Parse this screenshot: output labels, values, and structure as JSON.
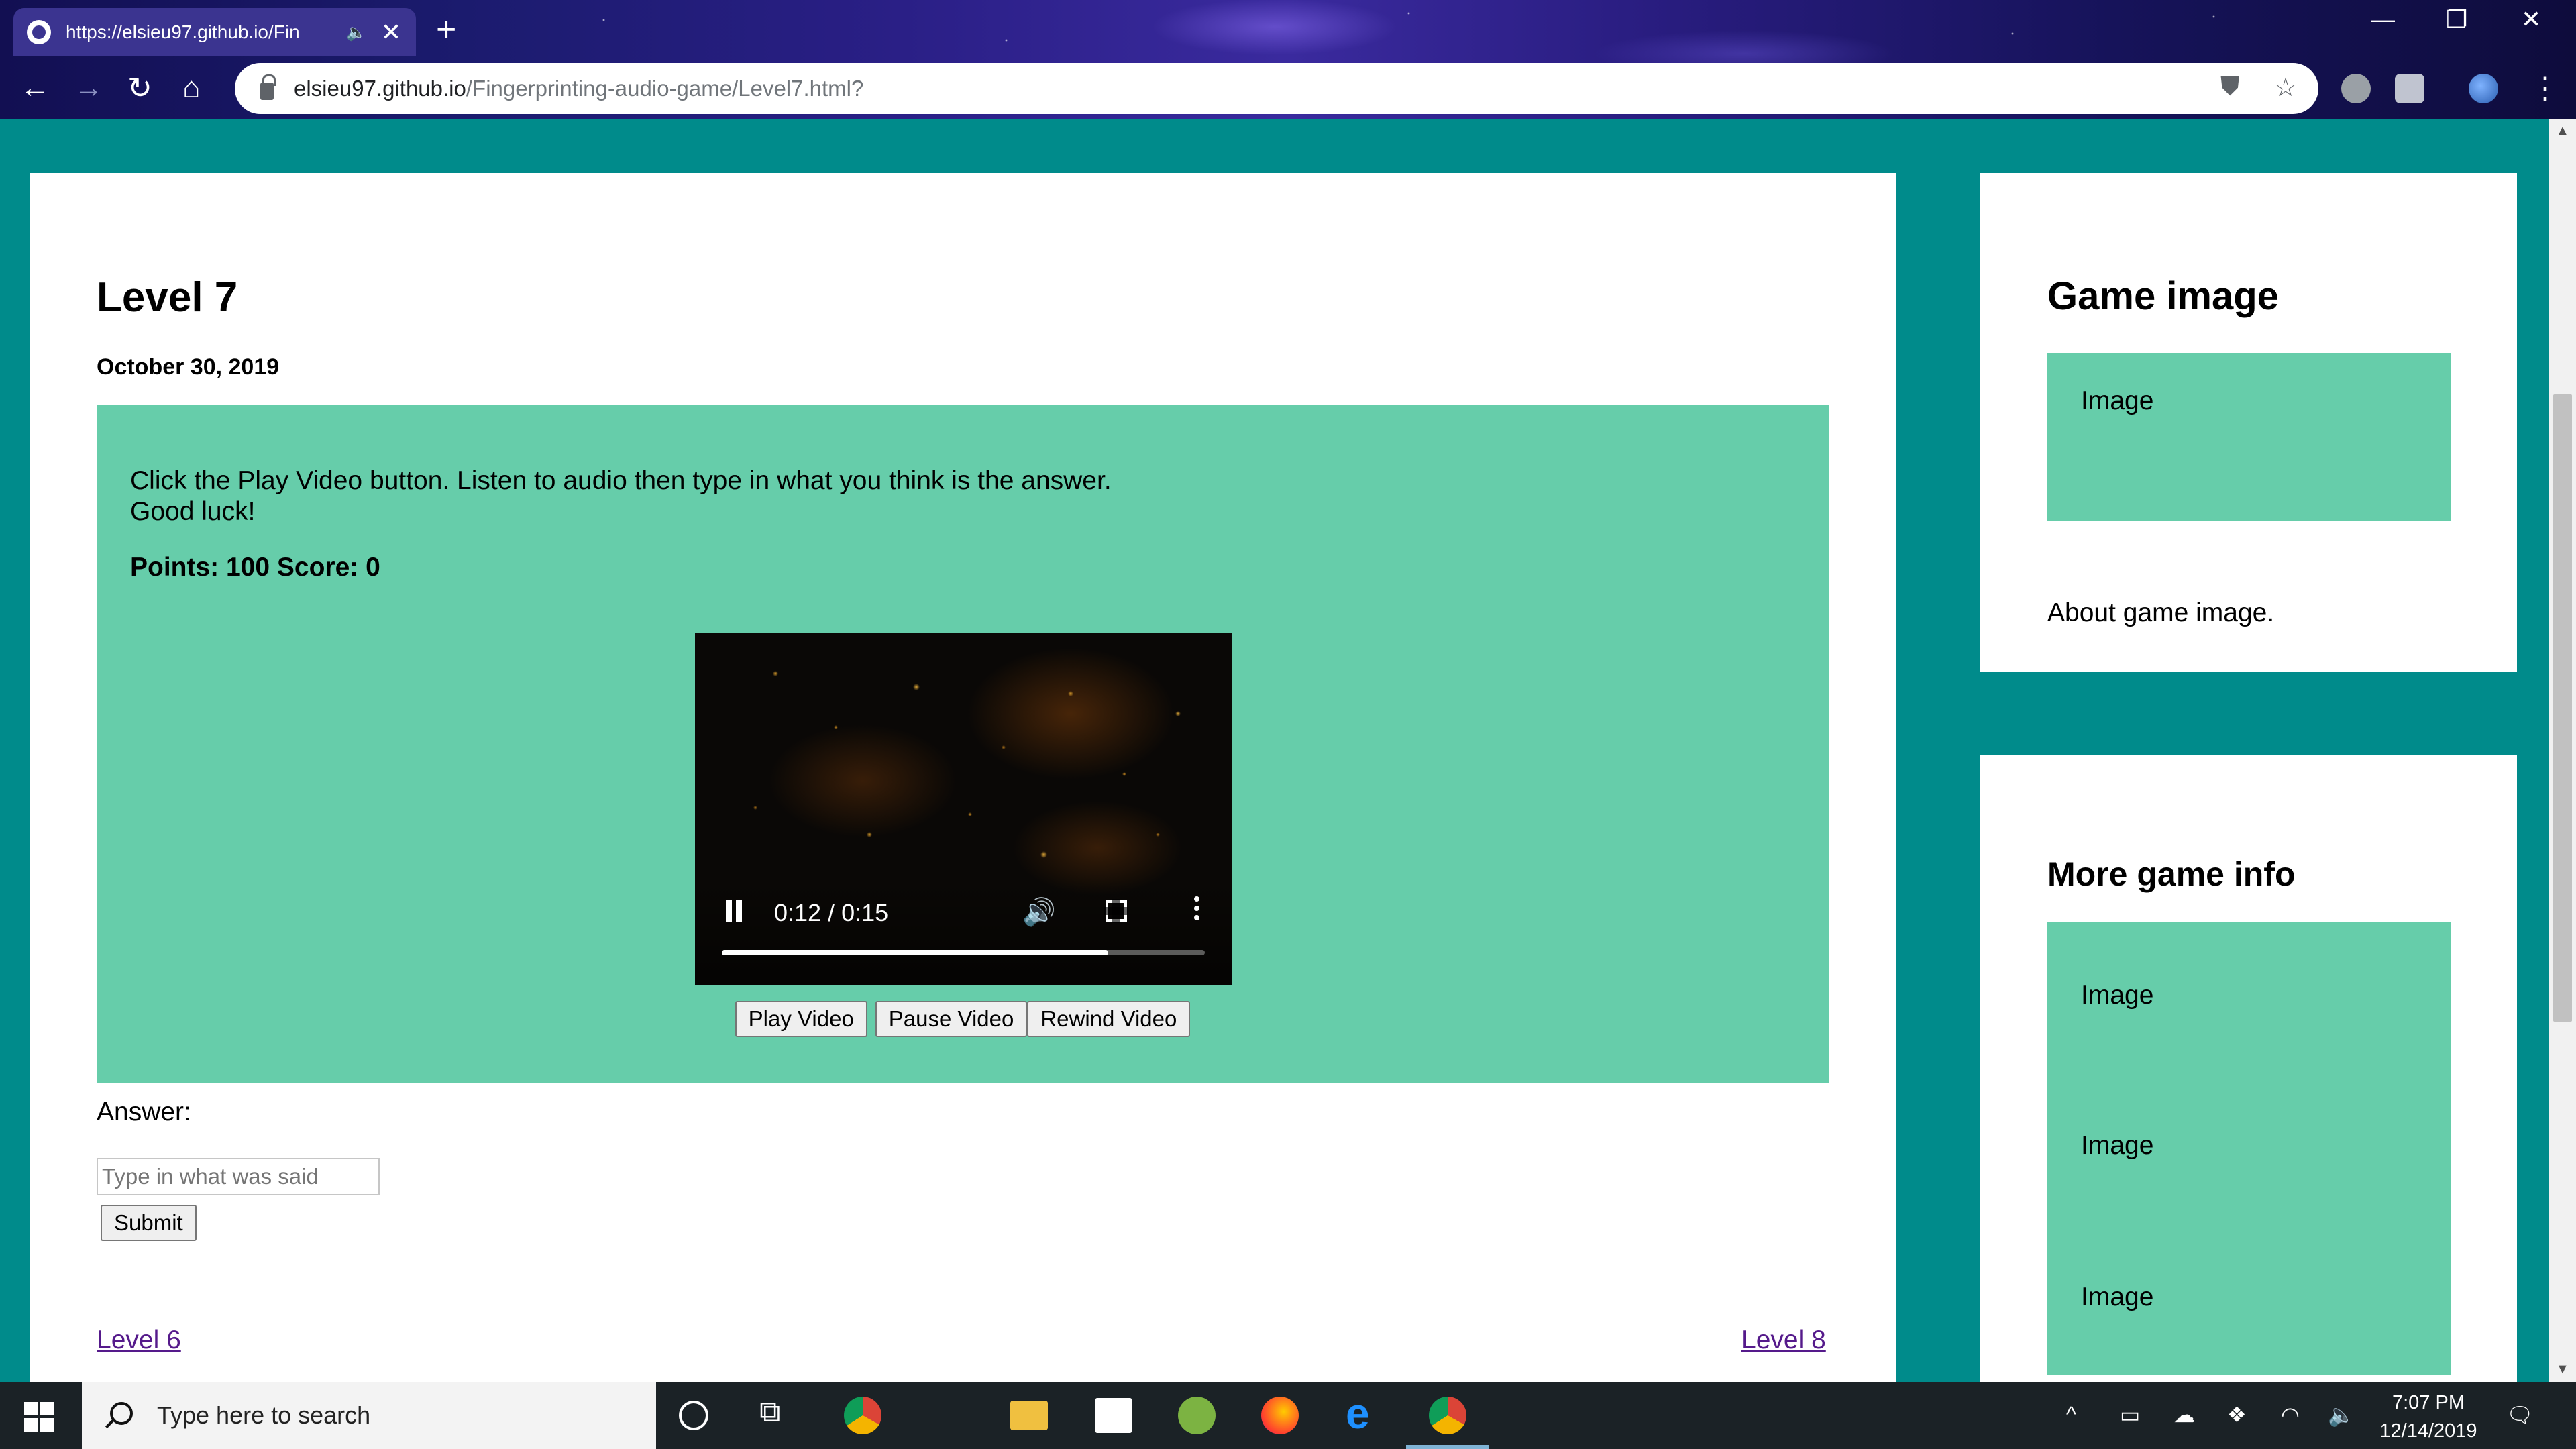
{
  "browser": {
    "tab_title": "https://elsieu97.github.io/Fin",
    "url_host": "elsieu97.github.io",
    "url_path": "/Fingerprinting-audio-game/Level7.html?"
  },
  "page": {
    "title": "Level 7",
    "date": "October 30, 2019",
    "instructions_line1": "Click the Play Video button. Listen to audio then type in what you think is the answer.",
    "instructions_line2": "Good luck!",
    "points_score": "Points: 100 Score: 0",
    "video": {
      "time_display": "0:12 / 0:15",
      "progress": 0.8
    },
    "buttons": {
      "play": "Play Video",
      "pause": "Pause Video",
      "rewind": "Rewind Video"
    },
    "answer_label": "Answer:",
    "answer_placeholder": "Type in what was said",
    "submit_label": "Submit",
    "prev_link": "Level 6",
    "next_link": "Level 8"
  },
  "sidebar": {
    "game_image_title": "Game image",
    "game_image_label": "Image",
    "game_image_about": "About game image.",
    "more_info_title": "More game info",
    "more_info_images": [
      "Image",
      "Image",
      "Image"
    ]
  },
  "taskbar": {
    "search_placeholder": "Type here to search",
    "time": "7:07 PM",
    "date": "12/14/2019"
  },
  "colors": {
    "page_background": "#008b8b",
    "game_box": "#66cdaa",
    "link": "#551a8b"
  }
}
